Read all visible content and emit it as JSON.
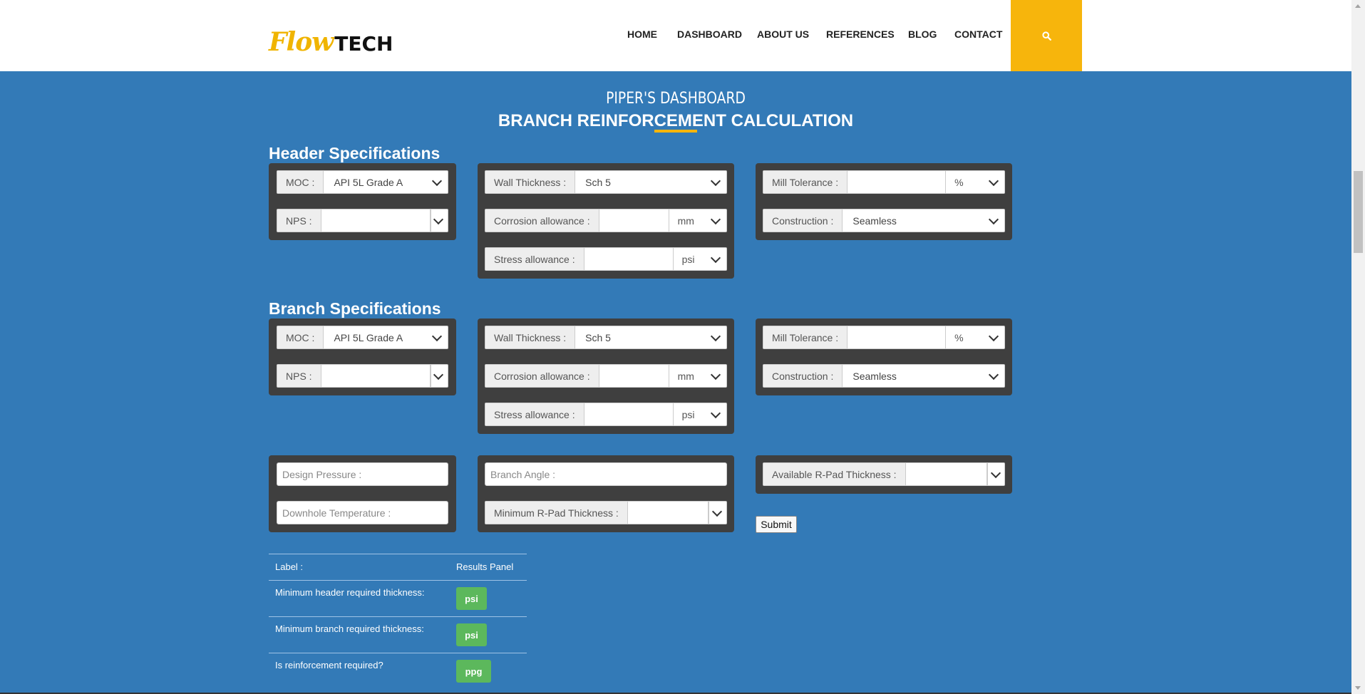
{
  "brand": {
    "logo_script": "Flow",
    "logo_tech": "TECH"
  },
  "nav": [
    {
      "label": "HOME"
    },
    {
      "label": "DASHBOARD"
    },
    {
      "label": "ABOUT US"
    },
    {
      "label": "REFERENCES"
    },
    {
      "label": "BLOG"
    },
    {
      "label": "CONTACT"
    }
  ],
  "colors": {
    "background": "#337ab7",
    "accent": "#f7b50c",
    "panel": "#3f3f3f",
    "badge": "#5cb85c"
  },
  "page": {
    "title_line1": "PIPER'S DASHBOARD",
    "title_line2": "BRANCH REINFORCEMENT CALCULATION"
  },
  "header_spec": {
    "title": "Header Specifications",
    "moc": {
      "label": "MOC :",
      "value": "API 5L Grade A"
    },
    "nps": {
      "label": "NPS :",
      "value": ""
    },
    "wall_thickness": {
      "label": "Wall Thickness :",
      "value": "Sch 5"
    },
    "corrosion": {
      "label": "Corrosion allowance :",
      "value": "",
      "unit": "mm"
    },
    "stress": {
      "label": "Stress allowance :",
      "value": "",
      "unit": "psi"
    },
    "mill_tolerance": {
      "label": "Mill Tolerance :",
      "value": "",
      "unit": "%"
    },
    "construction": {
      "label": "Construction :",
      "value": "Seamless"
    }
  },
  "branch_spec": {
    "title": "Branch Specifications",
    "moc": {
      "label": "MOC :",
      "value": "API 5L Grade A"
    },
    "nps": {
      "label": "NPS :",
      "value": ""
    },
    "wall_thickness": {
      "label": "Wall Thickness :",
      "value": "Sch 5"
    },
    "corrosion": {
      "label": "Corrosion allowance :",
      "value": "",
      "unit": "mm"
    },
    "stress": {
      "label": "Stress allowance :",
      "value": "",
      "unit": "psi"
    },
    "mill_tolerance": {
      "label": "Mill Tolerance :",
      "value": "",
      "unit": "%"
    },
    "construction": {
      "label": "Construction :",
      "value": "Seamless"
    }
  },
  "design": {
    "design_pressure_placeholder": "Design Pressure :",
    "downhole_temp_placeholder": "Downhole Temperature :",
    "branch_angle_placeholder": "Branch Angle :",
    "min_rpad": {
      "label": "Minimum R-Pad Thickness :",
      "value": ""
    },
    "avail_rpad": {
      "label": "Available R-Pad Thickness :",
      "value": ""
    },
    "submit_label": "Submit"
  },
  "results": {
    "col_label": "Label :",
    "col_results": "Results Panel",
    "rows": [
      {
        "label": "Minimum header required thickness:",
        "value": "psi"
      },
      {
        "label": "Minimum branch required thickness:",
        "value": "psi"
      },
      {
        "label": "Is reinforcement required?",
        "value": "ppg"
      }
    ]
  }
}
